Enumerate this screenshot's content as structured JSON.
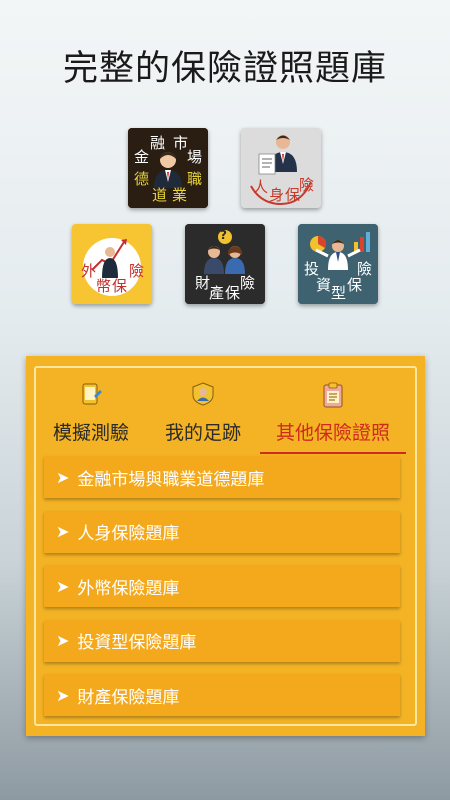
{
  "headline": "完整的保險證照題庫",
  "tiles": {
    "finance_ethics": {
      "chars": [
        "金",
        "融",
        "市",
        "場",
        "德",
        "道",
        "業",
        "職"
      ]
    },
    "life_insurance": {
      "chars": [
        "人",
        "身",
        "保",
        "險"
      ]
    },
    "foreign_currency": {
      "chars": [
        "外",
        "幣",
        "保",
        "險"
      ]
    },
    "property_insurance": {
      "chars": [
        "財",
        "產",
        "保",
        "險"
      ],
      "badge": "?"
    },
    "investment_insurance": {
      "chars": [
        "投",
        "資",
        "型",
        "保",
        "險"
      ]
    }
  },
  "tabs": [
    {
      "label": "模擬測驗",
      "icon": "tablet-icon",
      "active": false
    },
    {
      "label": "我的足跡",
      "icon": "user-badge-icon",
      "active": false
    },
    {
      "label": "其他保險證照",
      "icon": "clipboard-icon",
      "active": true
    }
  ],
  "list": [
    {
      "arrow": "➤",
      "label": "金融市場與職業道德題庫"
    },
    {
      "arrow": "➤",
      "label": "人身保險題庫"
    },
    {
      "arrow": "➤",
      "label": "外幣保險題庫"
    },
    {
      "arrow": "➤",
      "label": "投資型保險題庫"
    },
    {
      "arrow": "➤",
      "label": "財產保險題庫"
    }
  ],
  "colors": {
    "panel": "#f3b324",
    "list_item": "#f4a91d",
    "active_tab": "#d02a1e"
  }
}
